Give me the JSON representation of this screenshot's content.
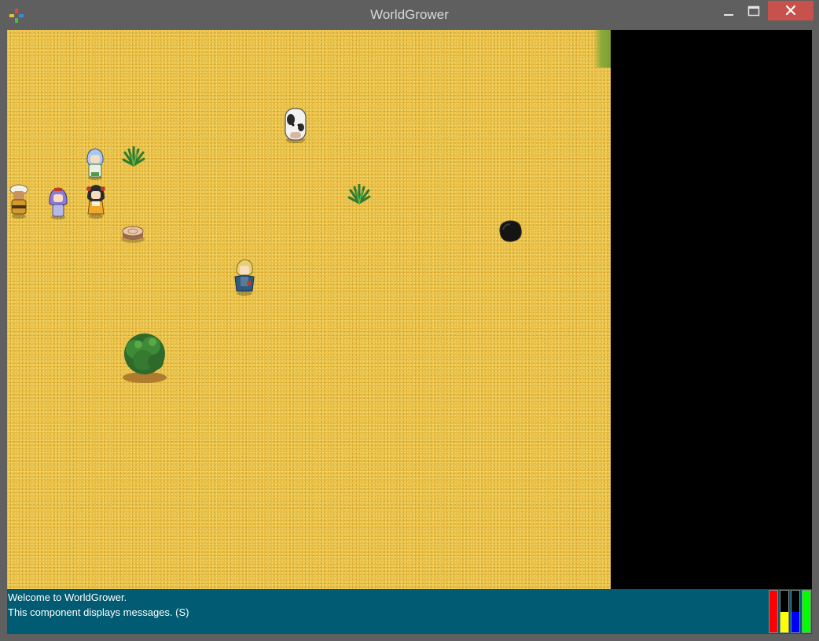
{
  "window": {
    "title": "WorldGrower",
    "controls": [
      "minimize-icon",
      "maximize-icon",
      "close-icon"
    ]
  },
  "map": {
    "terrain": "sand",
    "objects": [
      {
        "type": "cow",
        "icon": "cow-icon"
      },
      {
        "type": "villager",
        "icon": "villager-icon"
      },
      {
        "type": "villager",
        "icon": "villager-icon"
      },
      {
        "type": "villager",
        "icon": "villager-icon"
      },
      {
        "type": "villager",
        "icon": "villager-icon"
      },
      {
        "type": "player",
        "icon": "player-character-icon"
      },
      {
        "type": "grass tuft",
        "icon": "grass-tuft-icon"
      },
      {
        "type": "grass tuft",
        "icon": "grass-tuft-icon"
      },
      {
        "type": "tree stump",
        "icon": "tree-stump-icon"
      },
      {
        "type": "hole",
        "icon": "hole-icon"
      },
      {
        "type": "bush",
        "icon": "bush-icon"
      }
    ]
  },
  "messages": [
    "Welcome to WorldGrower.",
    "This component displays messages. (S)"
  ],
  "status_bars": [
    {
      "name": "health",
      "color": "#ff0000",
      "fraction": 1.0
    },
    {
      "name": "food",
      "color": "#ffff00",
      "fraction": 0.5
    },
    {
      "name": "water",
      "color": "#0000ff",
      "fraction": 0.5
    },
    {
      "name": "energy",
      "color": "#00ff00",
      "fraction": 1.0
    }
  ]
}
